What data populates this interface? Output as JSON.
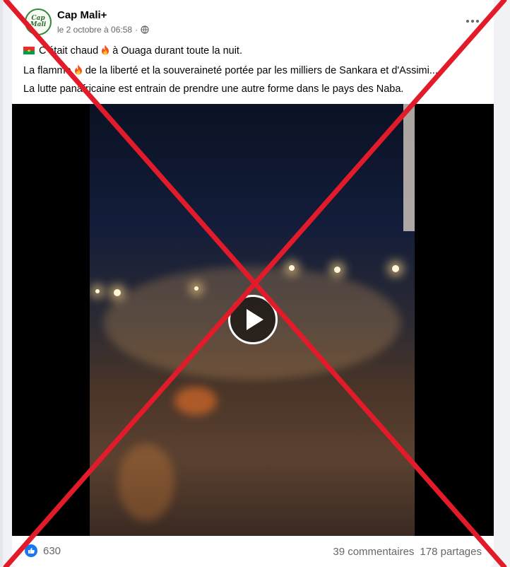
{
  "post": {
    "author": "Cap Mali+",
    "avatar_text": "Cap Mali",
    "timestamp": "le 2 octobre à 06:58",
    "separator": "·",
    "privacy_icon": "globe-icon",
    "more_icon": "more-options-icon",
    "text": {
      "line1_part1": "C'était chaud",
      "line1_part2": "à Ouaga durant toute la nuit.",
      "line2_part1": "La flamme",
      "line2_part2": "de la liberté et la souveraineté portée par les milliers de Sankara et d'Assimi...",
      "line3": "La lutte panafricaine est entrain de prendre une autre forme dans le pays des Naba."
    },
    "icons": {
      "flag": "burkina-faso-flag-icon",
      "fire": "fire-emoji-icon"
    }
  },
  "video": {
    "play_icon": "play-icon"
  },
  "footer": {
    "like_icon": "like-icon",
    "like_count": "630",
    "comments": "39 commentaires",
    "shares": "178 partages"
  },
  "overlay": {
    "cross_color": "#e21b2b"
  },
  "colors": {
    "brand": "#1877f2",
    "secondary_text": "#65676b"
  }
}
